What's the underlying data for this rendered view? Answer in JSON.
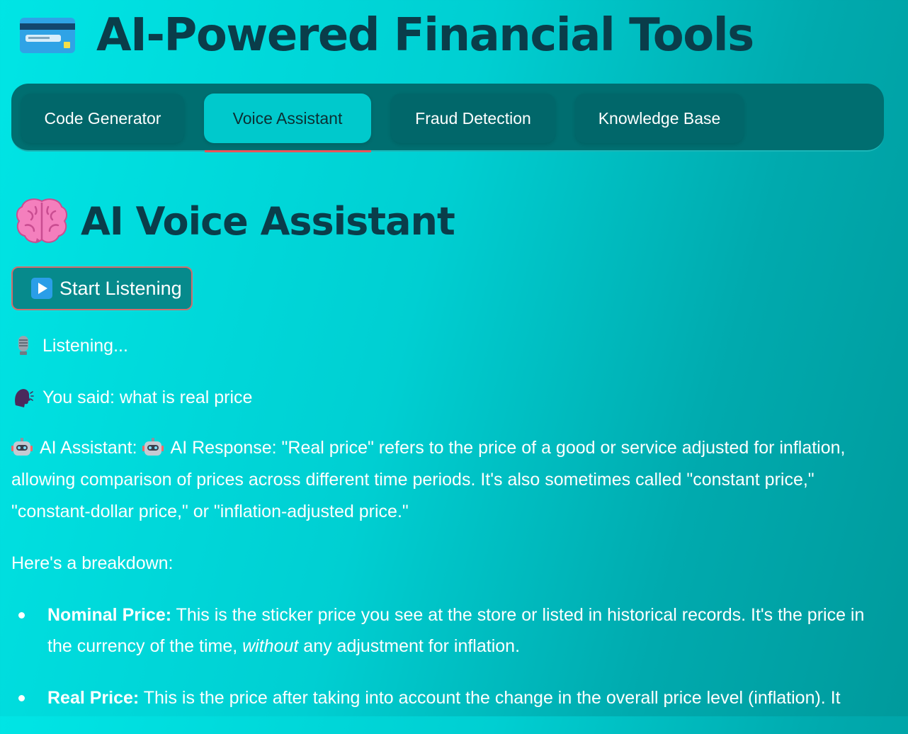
{
  "header": {
    "title": "AI-Powered Financial Tools",
    "icon": "credit-card-icon"
  },
  "tabs": [
    {
      "label": "Code Generator",
      "active": false
    },
    {
      "label": "Voice Assistant",
      "active": true
    },
    {
      "label": "Fraud Detection",
      "active": false
    },
    {
      "label": "Knowledge Base",
      "active": false
    }
  ],
  "section": {
    "title": "AI Voice Assistant",
    "icon": "brain-icon"
  },
  "listen_button": {
    "label": "Start Listening",
    "icon": "play-icon"
  },
  "status": {
    "listening": "Listening...",
    "you_said": "You said: what is real price"
  },
  "response": {
    "assistant_label": "AI Assistant:",
    "response_text": "AI Response: \"Real price\" refers to the price of a good or service adjusted for inflation, allowing comparison of prices across different time periods. It's also sometimes called \"constant price,\" \"constant-dollar price,\" or \"inflation-adjusted price.\"",
    "breakdown_intro": "Here's a breakdown:",
    "bullets": [
      {
        "term": "Nominal Price:",
        "text_before": " This is the sticker price you see at the store or listed in historical records. It's the price in the currency of the time, ",
        "emphasis": "without",
        "text_after": " any adjustment for inflation."
      },
      {
        "term": "Real Price:",
        "text_before": " This is the price after taking into account the change in the overall price level (inflation). It",
        "emphasis": "",
        "text_after": ""
      }
    ]
  },
  "colors": {
    "title": "#0a3d4a",
    "tabbar": "#006e70",
    "active_tab": "#00c9cc",
    "active_underline": "#e9545a",
    "button_border": "#d26d6d"
  }
}
